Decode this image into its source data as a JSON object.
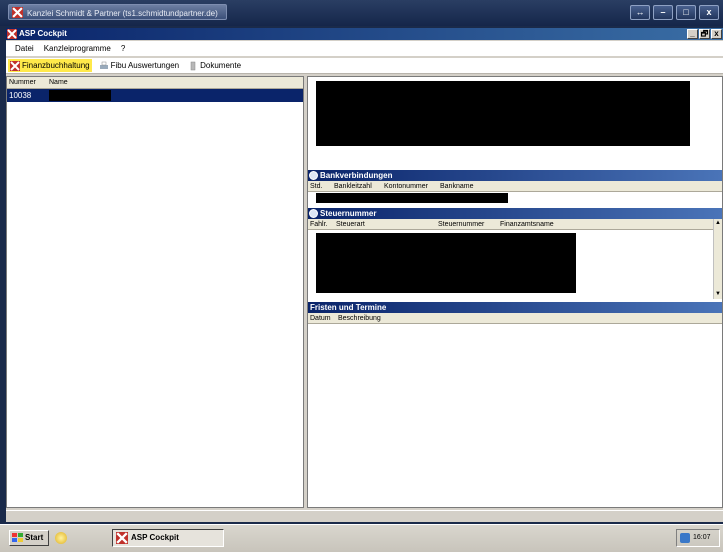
{
  "remote_window": {
    "title": "Kanzlei Schmidt & Partner (ts1.schmidtundpartner.de)",
    "buttons": [
      "↔",
      "–",
      "□",
      "x"
    ]
  },
  "app": {
    "title": "ASP Cockpit",
    "window_buttons": [
      "_",
      "🗗",
      "x"
    ]
  },
  "menu": {
    "items": [
      "Datei",
      "Kanzleiprogramme",
      "?"
    ]
  },
  "toolbar": {
    "finanz": "Finanzbuchhaltung",
    "fibu": "Fibu Auswertungen",
    "dokumente": "Dokumente"
  },
  "left_list": {
    "columns": [
      "Nummer",
      "Name"
    ],
    "rows": [
      {
        "nummer": "10038",
        "name": ""
      }
    ]
  },
  "sections": {
    "bank": {
      "title": "Bankverbindungen",
      "columns": [
        "Std.",
        "Bankleitzahl",
        "Kontonummer",
        "Bankname"
      ]
    },
    "steuer": {
      "title": "Steuernummer",
      "columns": [
        "Fahlr.",
        "Steuerart",
        "Steuernummer",
        "Finanzamtsname"
      ]
    },
    "fristen": {
      "title": "Fristen und Termine",
      "columns": [
        "Datum",
        "Beschreibung"
      ]
    }
  },
  "taskbar": {
    "start": "Start",
    "task": "ASP Cockpit",
    "clock": "16:07"
  }
}
